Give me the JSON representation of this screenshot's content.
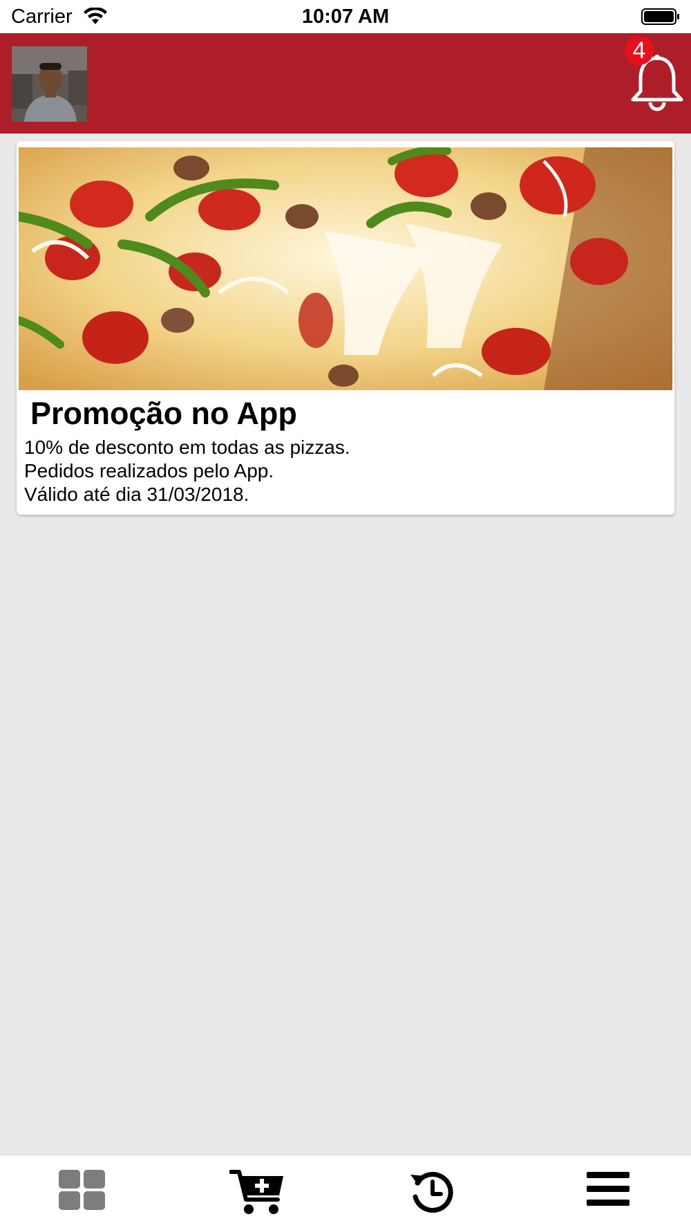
{
  "status_bar": {
    "carrier": "Carrier",
    "time": "10:07 AM"
  },
  "header": {
    "notification_count": "4"
  },
  "promo": {
    "title": "Promoção no App",
    "lines": [
      "10% de desconto em todas as pizzas.",
      "Pedidos realizados pelo App.",
      "Válido até dia 31/03/2018."
    ]
  },
  "tab_bar": {
    "items": [
      {
        "icon": "grid-icon",
        "active": true
      },
      {
        "icon": "add-to-cart-icon",
        "active": false
      },
      {
        "icon": "history-icon",
        "active": false
      },
      {
        "icon": "menu-icon",
        "active": false
      }
    ]
  },
  "colors": {
    "header": "#ad1e28",
    "badge": "#e8101c",
    "background": "#e9e9e9",
    "active_tab": "#7d7d7d",
    "inactive_tab": "#000000"
  }
}
